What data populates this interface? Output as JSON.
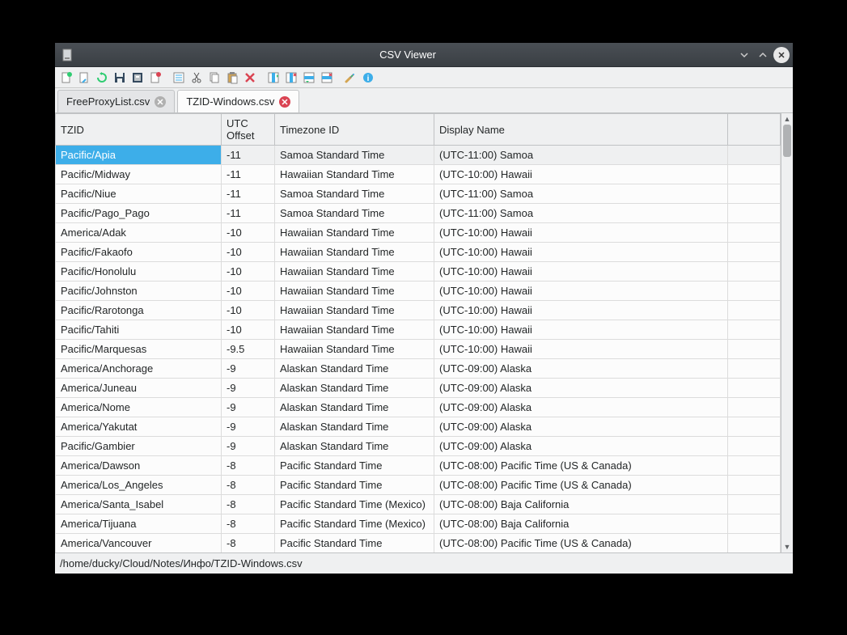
{
  "window": {
    "title": "CSV Viewer"
  },
  "tabs": [
    {
      "label": "FreeProxyList.csv",
      "active": false
    },
    {
      "label": "TZID-Windows.csv",
      "active": true
    }
  ],
  "columns": {
    "c0": "TZID",
    "c1": "UTC Offset",
    "c2": "Timezone ID",
    "c3": "Display Name"
  },
  "rows": [
    {
      "tzid": "Pacific/Apia",
      "offset": "-11",
      "tzname": "Samoa Standard Time",
      "display": "(UTC-11:00) Samoa"
    },
    {
      "tzid": "Pacific/Midway",
      "offset": "-11",
      "tzname": "Hawaiian Standard Time",
      "display": "(UTC-10:00) Hawaii"
    },
    {
      "tzid": "Pacific/Niue",
      "offset": "-11",
      "tzname": "Samoa Standard Time",
      "display": "(UTC-11:00) Samoa"
    },
    {
      "tzid": "Pacific/Pago_Pago",
      "offset": "-11",
      "tzname": "Samoa Standard Time",
      "display": "(UTC-11:00) Samoa"
    },
    {
      "tzid": "America/Adak",
      "offset": "-10",
      "tzname": "Hawaiian Standard Time",
      "display": "(UTC-10:00) Hawaii"
    },
    {
      "tzid": "Pacific/Fakaofo",
      "offset": "-10",
      "tzname": "Hawaiian Standard Time",
      "display": "(UTC-10:00) Hawaii"
    },
    {
      "tzid": "Pacific/Honolulu",
      "offset": "-10",
      "tzname": "Hawaiian Standard Time",
      "display": "(UTC-10:00) Hawaii"
    },
    {
      "tzid": "Pacific/Johnston",
      "offset": "-10",
      "tzname": "Hawaiian Standard Time",
      "display": "(UTC-10:00) Hawaii"
    },
    {
      "tzid": "Pacific/Rarotonga",
      "offset": "-10",
      "tzname": "Hawaiian Standard Time",
      "display": "(UTC-10:00) Hawaii"
    },
    {
      "tzid": "Pacific/Tahiti",
      "offset": "-10",
      "tzname": "Hawaiian Standard Time",
      "display": "(UTC-10:00) Hawaii"
    },
    {
      "tzid": "Pacific/Marquesas",
      "offset": "-9.5",
      "tzname": "Hawaiian Standard Time",
      "display": "(UTC-10:00) Hawaii"
    },
    {
      "tzid": "America/Anchorage",
      "offset": "-9",
      "tzname": "Alaskan Standard Time",
      "display": "(UTC-09:00) Alaska"
    },
    {
      "tzid": "America/Juneau",
      "offset": "-9",
      "tzname": "Alaskan Standard Time",
      "display": "(UTC-09:00) Alaska"
    },
    {
      "tzid": "America/Nome",
      "offset": "-9",
      "tzname": "Alaskan Standard Time",
      "display": "(UTC-09:00) Alaska"
    },
    {
      "tzid": "America/Yakutat",
      "offset": "-9",
      "tzname": "Alaskan Standard Time",
      "display": "(UTC-09:00) Alaska"
    },
    {
      "tzid": "Pacific/Gambier",
      "offset": "-9",
      "tzname": "Alaskan Standard Time",
      "display": "(UTC-09:00) Alaska"
    },
    {
      "tzid": "America/Dawson",
      "offset": "-8",
      "tzname": "Pacific Standard Time",
      "display": "(UTC-08:00) Pacific Time (US & Canada)"
    },
    {
      "tzid": "America/Los_Angeles",
      "offset": "-8",
      "tzname": "Pacific Standard Time",
      "display": "(UTC-08:00) Pacific Time (US & Canada)"
    },
    {
      "tzid": "America/Santa_Isabel",
      "offset": "-8",
      "tzname": "Pacific Standard Time (Mexico)",
      "display": "(UTC-08:00) Baja California"
    },
    {
      "tzid": "America/Tijuana",
      "offset": "-8",
      "tzname": "Pacific Standard Time (Mexico)",
      "display": "(UTC-08:00) Baja California"
    },
    {
      "tzid": "America/Vancouver",
      "offset": "-8",
      "tzname": "Pacific Standard Time",
      "display": "(UTC-08:00) Pacific Time (US & Canada)"
    }
  ],
  "statusbar": {
    "path": "/home/ducky/Cloud/Notes/Инфо/TZID-Windows.csv"
  },
  "icons": {
    "new": "new-file-icon",
    "open": "open-file-icon",
    "reload": "reload-icon",
    "save": "save-icon",
    "save_all": "save-all-icon",
    "close": "close-file-icon",
    "copy_all": "copy-all-icon",
    "cut": "cut-icon",
    "copy": "copy-icon",
    "paste": "paste-icon",
    "delete": "delete-icon",
    "insert_col": "insert-column-icon",
    "remove_col": "remove-column-icon",
    "insert_row": "insert-row-icon",
    "remove_row": "remove-row-icon",
    "settings": "settings-icon",
    "info": "info-icon"
  }
}
